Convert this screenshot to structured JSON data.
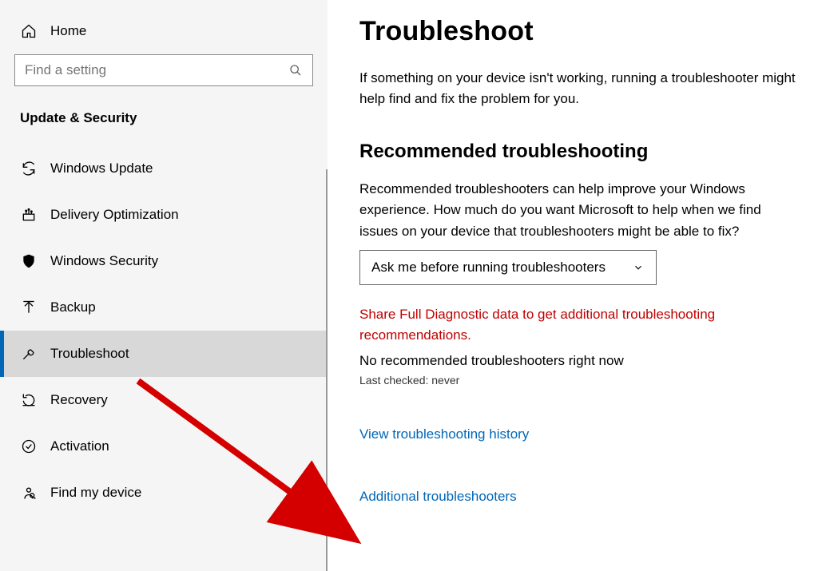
{
  "sidebar": {
    "home_label": "Home",
    "search_placeholder": "Find a setting",
    "section_title": "Update & Security",
    "items": [
      {
        "label": "Windows Update"
      },
      {
        "label": "Delivery Optimization"
      },
      {
        "label": "Windows Security"
      },
      {
        "label": "Backup"
      },
      {
        "label": "Troubleshoot"
      },
      {
        "label": "Recovery"
      },
      {
        "label": "Activation"
      },
      {
        "label": "Find my device"
      }
    ]
  },
  "main": {
    "title": "Troubleshoot",
    "intro": "If something on your device isn't working, running a troubleshooter might help find and fix the problem for you.",
    "rec_heading": "Recommended troubleshooting",
    "rec_paragraph": "Recommended troubleshooters can help improve your Windows experience. How much do you want Microsoft to help when we find issues on your device that troubleshooters might be able to fix?",
    "dropdown_value": "Ask me before running troubleshooters",
    "warning": "Share Full Diagnostic data to get additional troubleshooting recommendations.",
    "status": "No recommended troubleshooters right now",
    "last_checked": "Last checked: never",
    "link_history": "View troubleshooting history",
    "link_additional": "Additional troubleshooters"
  }
}
